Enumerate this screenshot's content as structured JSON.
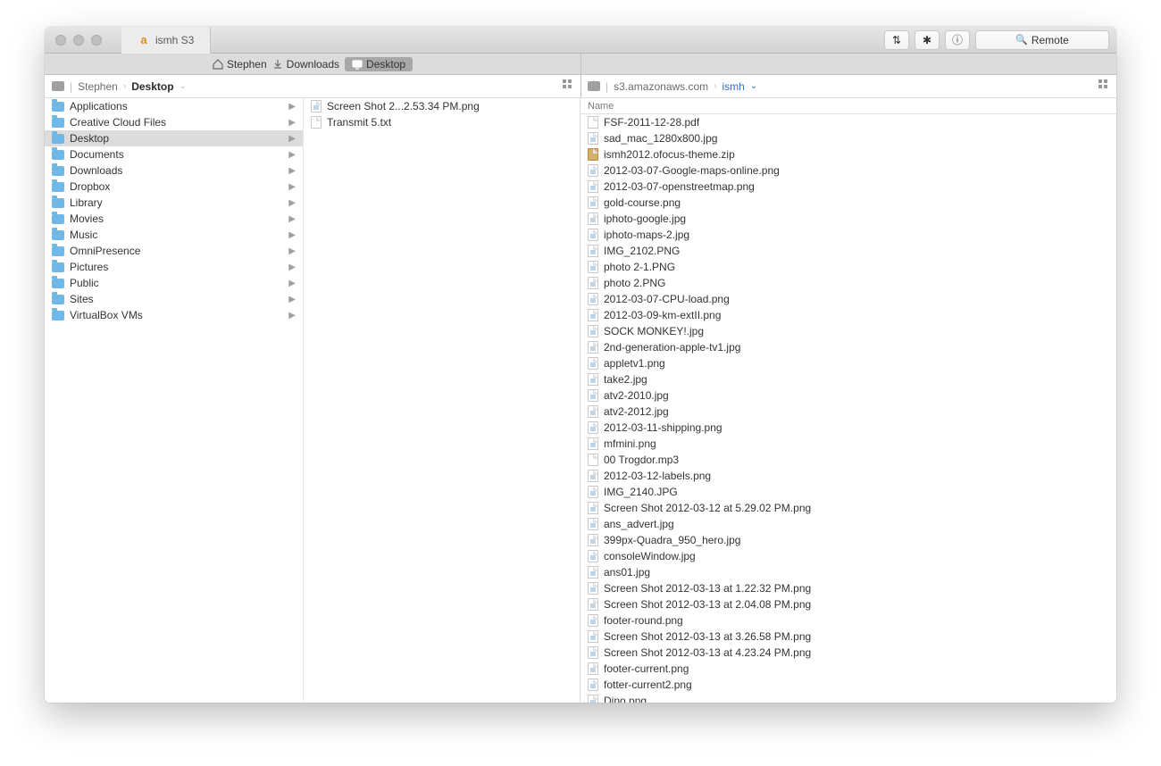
{
  "tab": {
    "title": "ismh S3"
  },
  "toolbar": {
    "remote_placeholder": "Remote"
  },
  "pathbar": {
    "left": [
      {
        "icon": "home",
        "label": "Stephen"
      },
      {
        "icon": "download",
        "label": "Downloads"
      },
      {
        "icon": "desktop",
        "label": "Desktop",
        "active": true
      }
    ]
  },
  "breadcrumb": {
    "left": {
      "segments": [
        {
          "label": "Stephen",
          "strong": false
        },
        {
          "label": "Desktop",
          "strong": true,
          "dropdown": true
        }
      ]
    },
    "right": {
      "segments": [
        {
          "label": "s3.amazonaws.com",
          "strong": false
        },
        {
          "label": "ismh",
          "link": true,
          "dropdown": true
        }
      ]
    }
  },
  "left_pane": {
    "folders": [
      {
        "name": "Applications"
      },
      {
        "name": "Creative Cloud Files"
      },
      {
        "name": "Desktop",
        "selected": true
      },
      {
        "name": "Documents"
      },
      {
        "name": "Downloads"
      },
      {
        "name": "Dropbox"
      },
      {
        "name": "Library"
      },
      {
        "name": "Movies"
      },
      {
        "name": "Music"
      },
      {
        "name": "OmniPresence"
      },
      {
        "name": "Pictures"
      },
      {
        "name": "Public"
      },
      {
        "name": "Sites"
      },
      {
        "name": "VirtualBox VMs"
      }
    ],
    "files": [
      {
        "name": "Screen Shot 2...2.53.34 PM.png",
        "kind": "img"
      },
      {
        "name": "Transmit 5.txt",
        "kind": "doc"
      }
    ]
  },
  "right_pane": {
    "header": "Name",
    "files": [
      {
        "name": "FSF-2011-12-28.pdf",
        "kind": "doc"
      },
      {
        "name": "sad_mac_1280x800.jpg",
        "kind": "img"
      },
      {
        "name": "ismh2012.ofocus-theme.zip",
        "kind": "zip"
      },
      {
        "name": "2012-03-07-Google-maps-online.png",
        "kind": "img"
      },
      {
        "name": "2012-03-07-openstreetmap.png",
        "kind": "img"
      },
      {
        "name": "gold-course.png",
        "kind": "img"
      },
      {
        "name": "iphoto-google.jpg",
        "kind": "img"
      },
      {
        "name": "iphoto-maps-2.jpg",
        "kind": "img"
      },
      {
        "name": "IMG_2102.PNG",
        "kind": "img"
      },
      {
        "name": "photo 2-1.PNG",
        "kind": "img"
      },
      {
        "name": "photo 2.PNG",
        "kind": "img"
      },
      {
        "name": "2012-03-07-CPU-load.png",
        "kind": "img"
      },
      {
        "name": "2012-03-09-km-extII.png",
        "kind": "img"
      },
      {
        "name": "SOCK MONKEY!.jpg",
        "kind": "img"
      },
      {
        "name": "2nd-generation-apple-tv1.jpg",
        "kind": "img"
      },
      {
        "name": "appletv1.png",
        "kind": "img"
      },
      {
        "name": "take2.jpg",
        "kind": "img"
      },
      {
        "name": "atv2-2010.jpg",
        "kind": "img"
      },
      {
        "name": "atv2-2012.jpg",
        "kind": "img"
      },
      {
        "name": "2012-03-11-shipping.png",
        "kind": "img"
      },
      {
        "name": "mfmini.png",
        "kind": "img"
      },
      {
        "name": "00 Trogdor.mp3",
        "kind": "doc"
      },
      {
        "name": "2012-03-12-labels.png",
        "kind": "img"
      },
      {
        "name": "IMG_2140.JPG",
        "kind": "img"
      },
      {
        "name": "Screen Shot 2012-03-12 at 5.29.02 PM.png",
        "kind": "img"
      },
      {
        "name": "ans_advert.jpg",
        "kind": "img"
      },
      {
        "name": "399px-Quadra_950_hero.jpg",
        "kind": "img"
      },
      {
        "name": "consoleWindow.jpg",
        "kind": "img"
      },
      {
        "name": "ans01.jpg",
        "kind": "img"
      },
      {
        "name": "Screen Shot 2012-03-13 at 1.22.32 PM.png",
        "kind": "img"
      },
      {
        "name": "Screen Shot 2012-03-13 at 2.04.08 PM.png",
        "kind": "img"
      },
      {
        "name": "footer-round.png",
        "kind": "img"
      },
      {
        "name": "Screen Shot 2012-03-13 at 3.26.58 PM.png",
        "kind": "img"
      },
      {
        "name": "Screen Shot 2012-03-13 at 4.23.24 PM.png",
        "kind": "img"
      },
      {
        "name": "footer-current.png",
        "kind": "img"
      },
      {
        "name": "fotter-current2.png",
        "kind": "img"
      },
      {
        "name": "Dino.png",
        "kind": "img"
      }
    ]
  }
}
